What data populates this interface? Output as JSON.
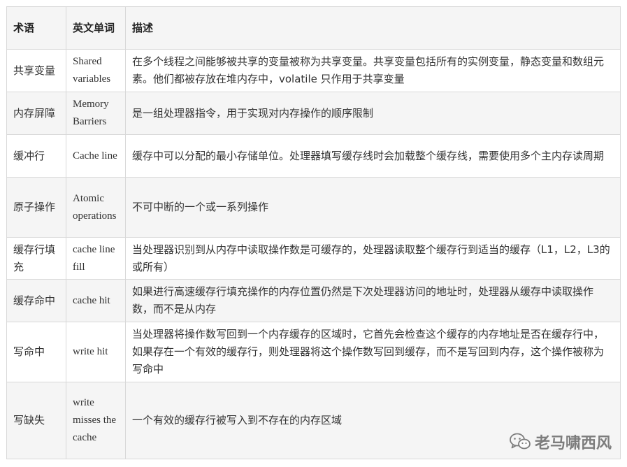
{
  "table": {
    "headers": [
      "术语",
      "英文单词",
      "描述"
    ],
    "rows": [
      {
        "term": "共享变量",
        "en": "Shared variables",
        "desc": "在多个线程之间能够被共享的变量被称为共享变量。共享变量包括所有的实例变量，静态变量和数组元素。他们都被存放在堆内存中，volatile 只作用于共享变量"
      },
      {
        "term": "内存屏障",
        "en": "Memory Barriers",
        "desc": "是一组处理器指令，用于实现对内存操作的顺序限制"
      },
      {
        "term": "缓冲行",
        "en": "Cache line",
        "desc": "缓存中可以分配的最小存储单位。处理器填写缓存线时会加载整个缓存线，需要使用多个主内存读周期"
      },
      {
        "term": "原子操作",
        "en": "Atomic operations",
        "desc": "不可中断的一个或一系列操作"
      },
      {
        "term": "缓存行填充",
        "en": "cache line fill",
        "desc": "当处理器识别到从内存中读取操作数是可缓存的，处理器读取整个缓存行到适当的缓存（L1，L2，L3的或所有）"
      },
      {
        "term": "缓存命中",
        "en": "cache hit",
        "desc": "如果进行高速缓存行填充操作的内存位置仍然是下次处理器访问的地址时，处理器从缓存中读取操作数，而不是从内存"
      },
      {
        "term": "写命中",
        "en": "write hit",
        "desc": "当处理器将操作数写回到一个内存缓存的区域时，它首先会检查这个缓存的内存地址是否在缓存行中，如果存在一个有效的缓存行，则处理器将这个操作数写回到缓存，而不是写回到内存，这个操作被称为写命中"
      },
      {
        "term": "写缺失",
        "en": "write misses the cache",
        "desc": "一个有效的缓存行被写入到不存在的内存区域"
      }
    ]
  },
  "watermark": {
    "icon": "wechat-icon",
    "text": "老马啸西风"
  }
}
